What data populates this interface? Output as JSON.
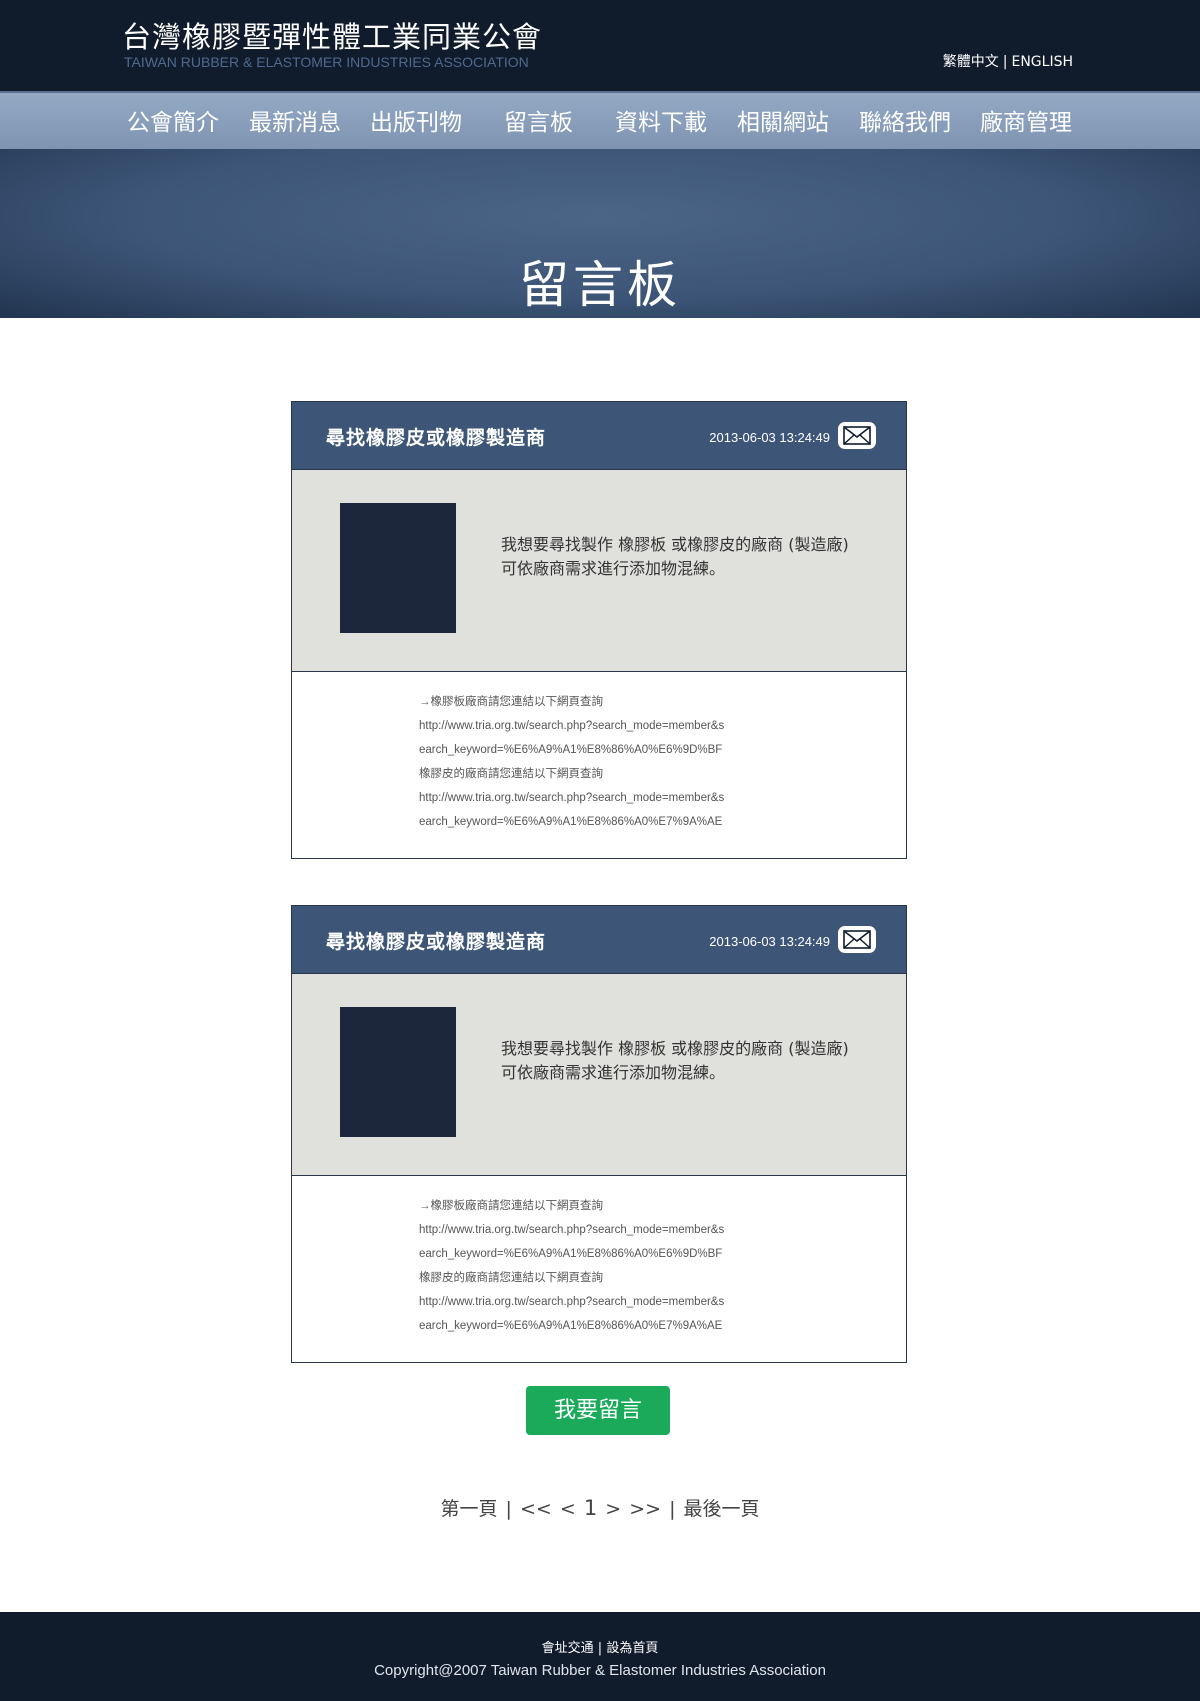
{
  "header": {
    "title": "台灣橡膠暨彈性體工業同業公會",
    "subtitle": "TAIWAN RUBBER & ELASTOMER INDUSTRIES ASSOCIATION",
    "lang_zh": "繁體中文",
    "lang_sep": "|",
    "lang_en": "ENGLISH"
  },
  "nav": {
    "items": [
      {
        "label": "公會簡介"
      },
      {
        "label": "最新消息"
      },
      {
        "label": "出版刊物"
      },
      {
        "label": "留言板"
      },
      {
        "label": "資料下載"
      },
      {
        "label": "相關網站"
      },
      {
        "label": "聯絡我們"
      },
      {
        "label": "廠商管理"
      }
    ]
  },
  "hero": {
    "title": "留言板"
  },
  "posts": [
    {
      "title": "尋找橡膠皮或橡膠製造商",
      "date": "2013-06-03 13:24:49",
      "content_line1": "我想要尋找製作 橡膠板 或橡膠皮的廠商 (製造廠)",
      "content_line2": "可依廠商需求進行添加物混練。",
      "reply": [
        "→橡膠板廠商請您連結以下網頁查詢",
        "http://www.tria.org.tw/search.php?search_mode=member&s",
        "earch_keyword=%E6%A9%A1%E8%86%A0%E6%9D%BF",
        "橡膠皮的廠商請您連結以下網頁查詢",
        "http://www.tria.org.tw/search.php?search_mode=member&s",
        "earch_keyword=%E6%A9%A1%E8%86%A0%E7%9A%AE"
      ]
    },
    {
      "title": "尋找橡膠皮或橡膠製造商",
      "date": "2013-06-03 13:24:49",
      "content_line1": "我想要尋找製作 橡膠板 或橡膠皮的廠商 (製造廠)",
      "content_line2": "可依廠商需求進行添加物混練。",
      "reply": [
        "→橡膠板廠商請您連結以下網頁查詢",
        "http://www.tria.org.tw/search.php?search_mode=member&s",
        "earch_keyword=%E6%A9%A1%E8%86%A0%E6%9D%BF",
        "橡膠皮的廠商請您連結以下網頁查詢",
        "http://www.tria.org.tw/search.php?search_mode=member&s",
        "earch_keyword=%E6%A9%A1%E8%86%A0%E7%9A%AE"
      ]
    }
  ],
  "leave_message_button": "我要留言",
  "pager": {
    "first": "第一頁",
    "sep": "|",
    "prev_block": "<<",
    "prev": "<",
    "current": "1",
    "next": ">",
    "next_block": ">>",
    "last": "最後一頁"
  },
  "footer": {
    "traffic": "會址交通",
    "sep": "|",
    "set_home": "設為首頁",
    "copyright": "Copyright@2007 Taiwan Rubber & Elastomer Industries Association"
  },
  "colors": {
    "header_bg": "#101b2b",
    "nav_bg": "#8aa0bc",
    "post_head_bg": "#3d5678",
    "post_body_bg": "#e0e0dd",
    "avatar": "#1c273c",
    "button_green": "#1aaa5a"
  },
  "icons": {
    "mail": "envelope-icon"
  }
}
